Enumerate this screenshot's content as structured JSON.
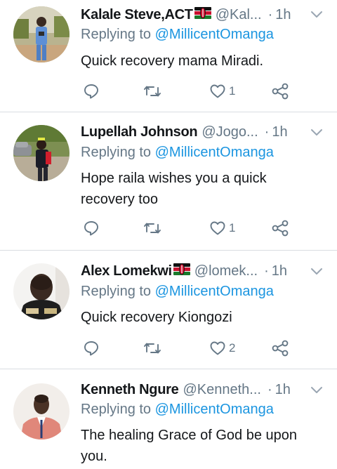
{
  "tweets": [
    {
      "name": "Kalale Steve,ACT",
      "has_flag": true,
      "handle": "@Kal...",
      "separator": "·",
      "time": "1h",
      "replying_prefix": "Replying to ",
      "replying_to": "@MillicentOmanga",
      "text": "Quick recovery mama Miradi.",
      "reply_count": "",
      "retweet_count": "",
      "like_count": "1"
    },
    {
      "name": "Lupellah Johnson",
      "has_flag": false,
      "handle": "@Jogo...",
      "separator": "·",
      "time": "1h",
      "replying_prefix": "Replying to ",
      "replying_to": "@MillicentOmanga",
      "text": "Hope raila wishes you a quick recovery too",
      "reply_count": "",
      "retweet_count": "",
      "like_count": "1"
    },
    {
      "name": "Alex Lomekwi",
      "has_flag": true,
      "handle": "@lomek...",
      "separator": "·",
      "time": "1h",
      "replying_prefix": "Replying to ",
      "replying_to": "@MillicentOmanga",
      "text": "Quick recovery Kiongozi",
      "reply_count": "",
      "retweet_count": "",
      "like_count": "2"
    },
    {
      "name": "Kenneth Ngure",
      "has_flag": false,
      "handle": "@Kenneth...",
      "separator": "·",
      "time": "1h",
      "replying_prefix": "Replying to ",
      "replying_to": "@MillicentOmanga",
      "text": "The healing Grace of God be upon you.",
      "reply_count": "",
      "retweet_count": "",
      "like_count": ""
    }
  ],
  "icons": {
    "reply": "reply-icon",
    "retweet": "retweet-icon",
    "like": "heart-icon",
    "share": "share-icon",
    "more": "chevron-down-icon",
    "flag": "kenya-flag-icon"
  },
  "colors": {
    "text": "#14171a",
    "secondary": "#657786",
    "mention": "#1b95e0",
    "divider": "#d9dde1"
  }
}
